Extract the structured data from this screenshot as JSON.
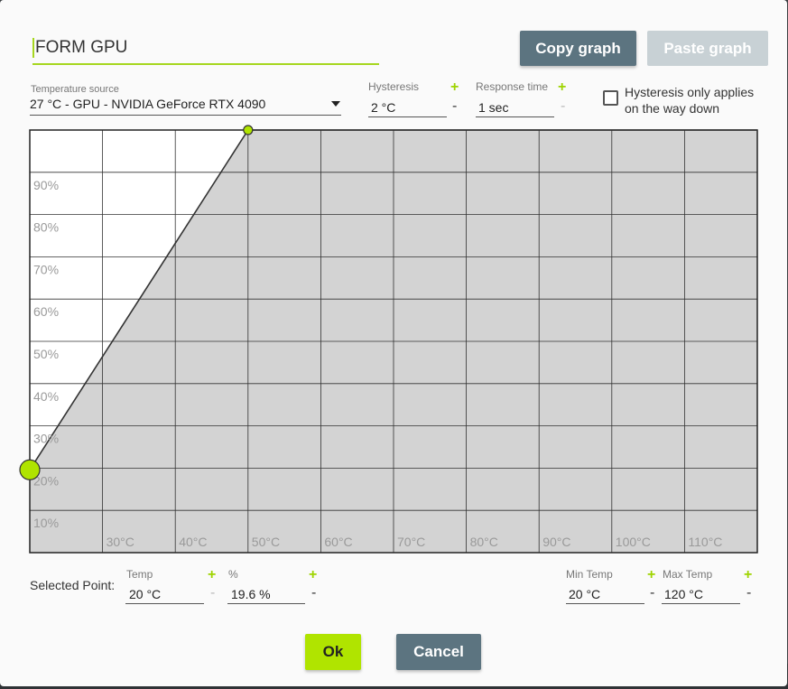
{
  "dialog": {
    "name_value": "FORM GPU",
    "copy_graph_label": "Copy graph",
    "paste_graph_label": "Paste graph",
    "ok_label": "Ok",
    "cancel_label": "Cancel"
  },
  "temperature_source": {
    "label": "Temperature source",
    "value": "27 °C - GPU - NVIDIA GeForce RTX 4090"
  },
  "hysteresis": {
    "label": "Hysteresis",
    "value": "2 °C"
  },
  "response_time": {
    "label": "Response time",
    "value": "1 sec"
  },
  "hysteresis_way_down": {
    "label": "Hysteresis only applies on the way down",
    "checked": false
  },
  "selected_point": {
    "label": "Selected Point:",
    "temp_label": "Temp",
    "temp_value": "20 °C",
    "pct_label": "%",
    "pct_value": "19.6 %"
  },
  "range": {
    "min_label": "Min Temp",
    "min_value": "20 °C",
    "max_label": "Max Temp",
    "max_value": "120 °C"
  },
  "controls": {
    "plus": "+",
    "minus": "-"
  },
  "colors": {
    "accent": "#a6d61f",
    "button_primary": "#5c7480",
    "fill_area": "#d3d3d3"
  },
  "chart_data": {
    "type": "area",
    "x_ticks": [
      "30°C",
      "40°C",
      "50°C",
      "60°C",
      "70°C",
      "80°C",
      "90°C",
      "100°C",
      "110°C"
    ],
    "y_ticks": [
      "10%",
      "20%",
      "30%",
      "40%",
      "50%",
      "60%",
      "70%",
      "80%",
      "90%"
    ],
    "xlim": [
      20,
      120
    ],
    "ylim": [
      0,
      100
    ],
    "grid": true,
    "points": [
      {
        "x": 20,
        "y": 19.6
      },
      {
        "x": 50,
        "y": 100
      }
    ],
    "selected_point_index": 0
  }
}
